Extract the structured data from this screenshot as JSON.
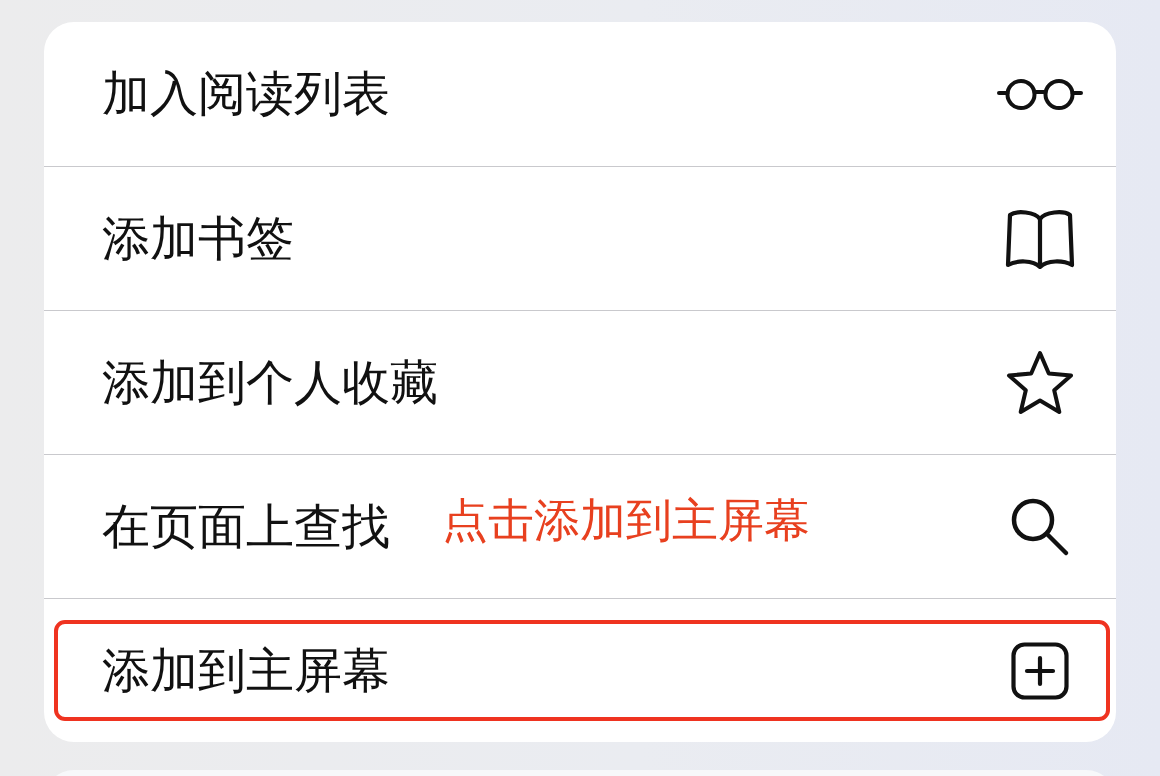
{
  "menu": {
    "items": [
      {
        "label": "加入阅读列表",
        "highlighted": false
      },
      {
        "label": "添加书签",
        "highlighted": false
      },
      {
        "label": "添加到个人收藏",
        "highlighted": false
      },
      {
        "label": "在页面上查找",
        "highlighted": false,
        "annotation": "点击添加到主屏幕"
      },
      {
        "label": "添加到主屏幕",
        "highlighted": true
      }
    ]
  }
}
